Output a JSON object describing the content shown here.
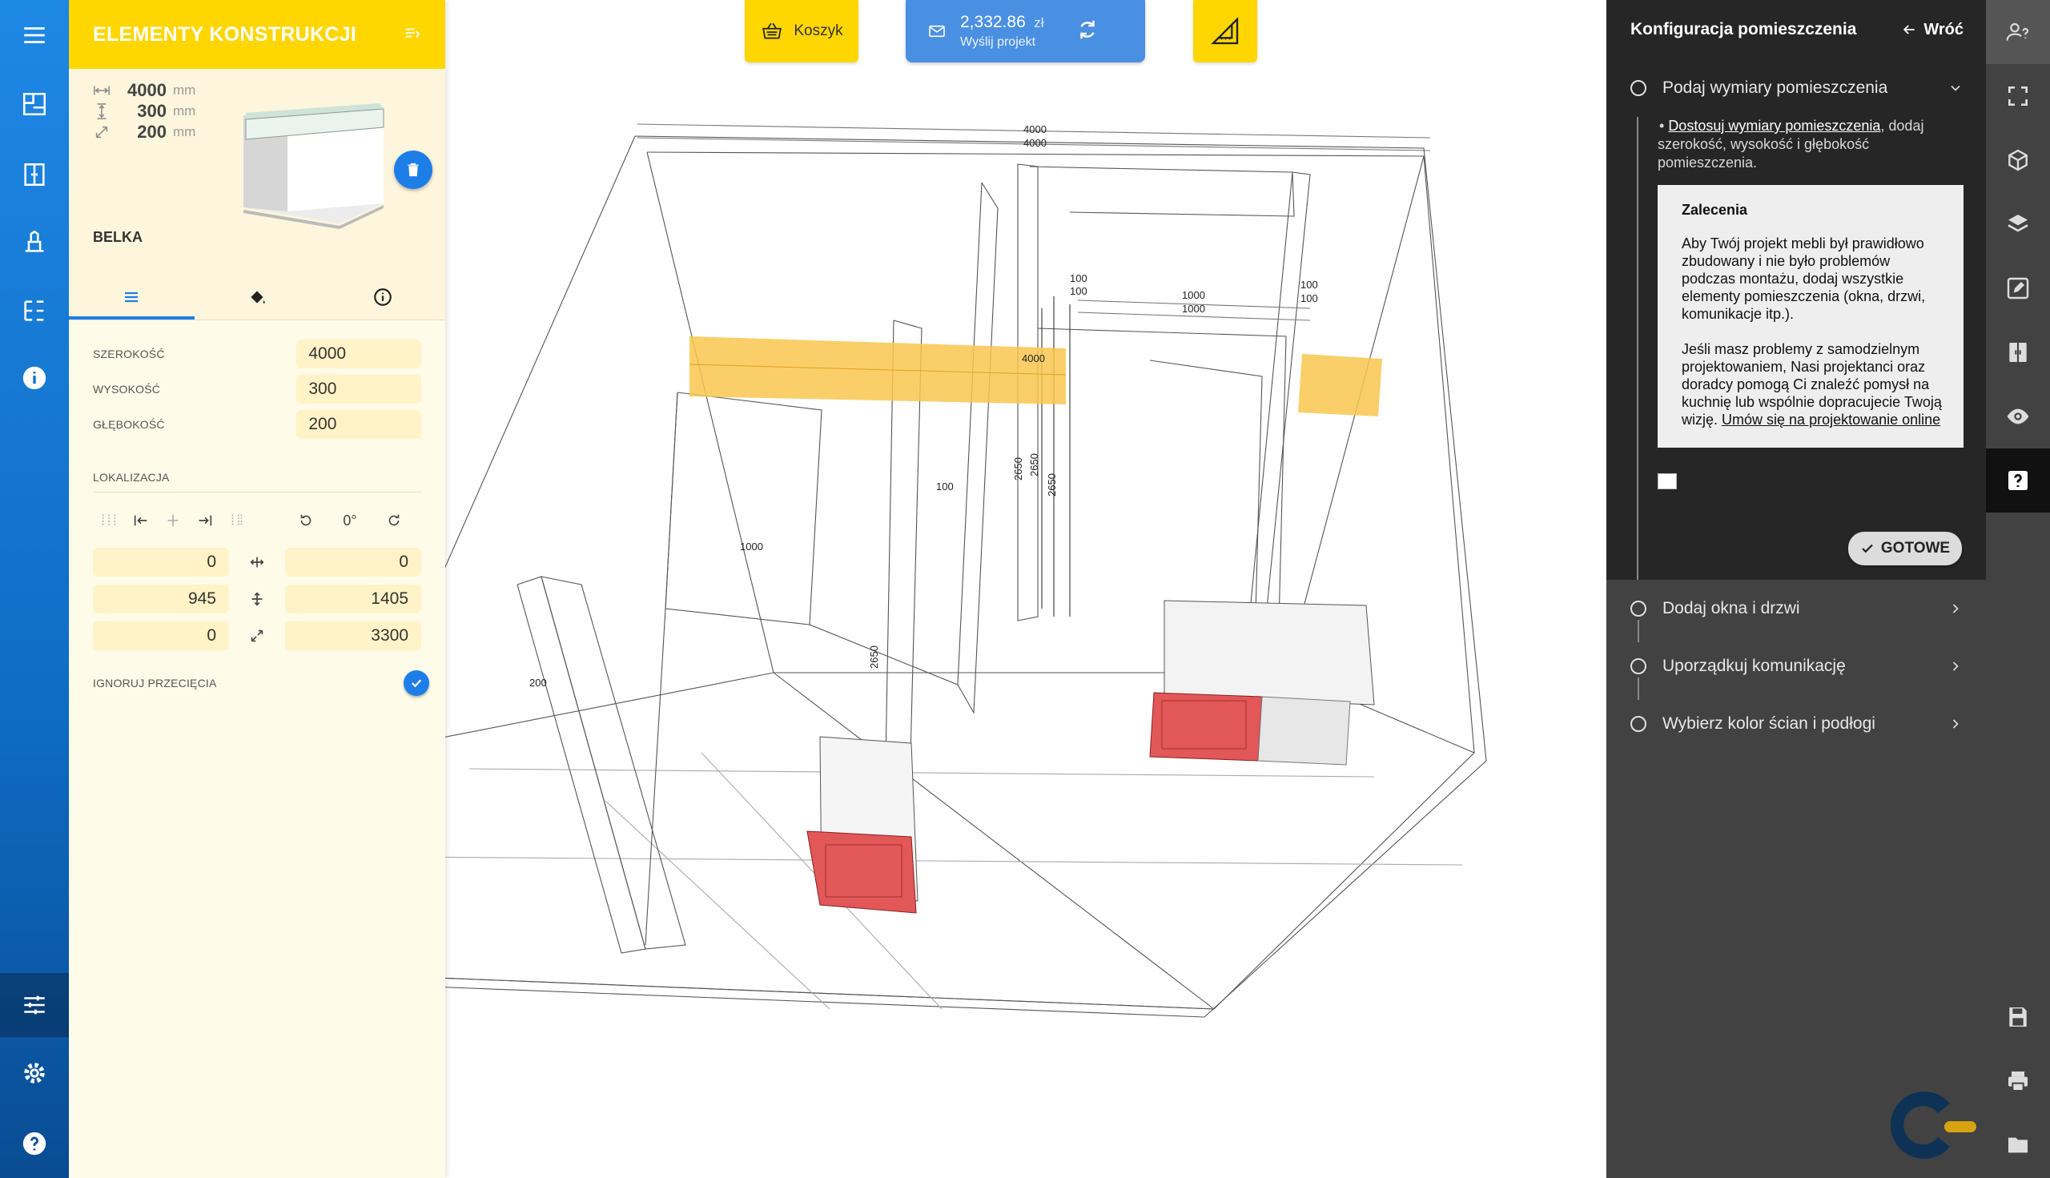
{
  "left_rail": {
    "items": [
      "menu-icon",
      "floorplan-icon",
      "cabinet-icon",
      "furniture-icon",
      "tree-icon",
      "info-icon",
      "sliders-icon",
      "gear-icon",
      "help-icon"
    ]
  },
  "props": {
    "header_title": "ELEMENTY KONSTRUKCJI",
    "dims": [
      {
        "value": "4000",
        "unit": "mm"
      },
      {
        "value": "300",
        "unit": "mm"
      },
      {
        "value": "200",
        "unit": "mm"
      }
    ],
    "element_name": "BELKA",
    "fields": [
      {
        "label": "SZEROKOŚĆ",
        "value": "4000"
      },
      {
        "label": "WYSOKOŚĆ",
        "value": "300"
      },
      {
        "label": "GŁĘBOKOŚĆ",
        "value": "200"
      }
    ],
    "location_label": "LOKALIZACJA",
    "rotation_value": "0°",
    "location_rows": [
      {
        "left": "0",
        "right": "0"
      },
      {
        "left": "945",
        "right": "1405"
      },
      {
        "left": "0",
        "right": "3300"
      }
    ],
    "ignore_label": "IGNORUJ PRZECIĘCIA"
  },
  "toolbar": {
    "cart_label": "Koszyk",
    "price": "2,332.86",
    "currency": "zł",
    "send_label": "Wyślij projekt"
  },
  "scene": {
    "labels": [
      "4000",
      "4000",
      "100",
      "100",
      "1000",
      "1000",
      "100",
      "100",
      "4000",
      "2650",
      "2650",
      "2650",
      "100",
      "1000",
      "200",
      "2650"
    ]
  },
  "config": {
    "title": "Konfiguracja pomieszczenia",
    "back_label": "Wróć",
    "steps": [
      "Podaj wymiary pomieszczenia",
      "Dodaj okna i drzwi",
      "Uporządkuj komunikację",
      "Wybierz kolor ścian i podłogi"
    ],
    "bullet_link": "Dostosuj wymiary pomieszczenia",
    "bullet_rest": ", dodaj szerokość, wysokość i głębokość pomieszczenia.",
    "recommend_title": "Zalecenia",
    "recommend_p1": "Aby Twój projekt mebli był prawidłowo zbudowany i nie było problemów podczas montażu, dodaj wszystkie elementy pomieszczenia (okna, drzwi, komunikacje itp.).",
    "recommend_p2": "Jeśli masz problemy z samodzielnym projektowaniem, Nasi projektanci oraz doradcy pomogą Ci znaleźć pomysł na kuchnię lub wspólnie dopracujecie Twoją wizję.",
    "recommend_link": "Umów się na projektowanie online",
    "done_label": "GOTOWE"
  },
  "colors": {
    "blue": "#1e7ee8",
    "yellow": "#ffd600",
    "dark": "#262626",
    "highlight_beam": "#f9c74f",
    "cabinet_red": "#e05555"
  }
}
